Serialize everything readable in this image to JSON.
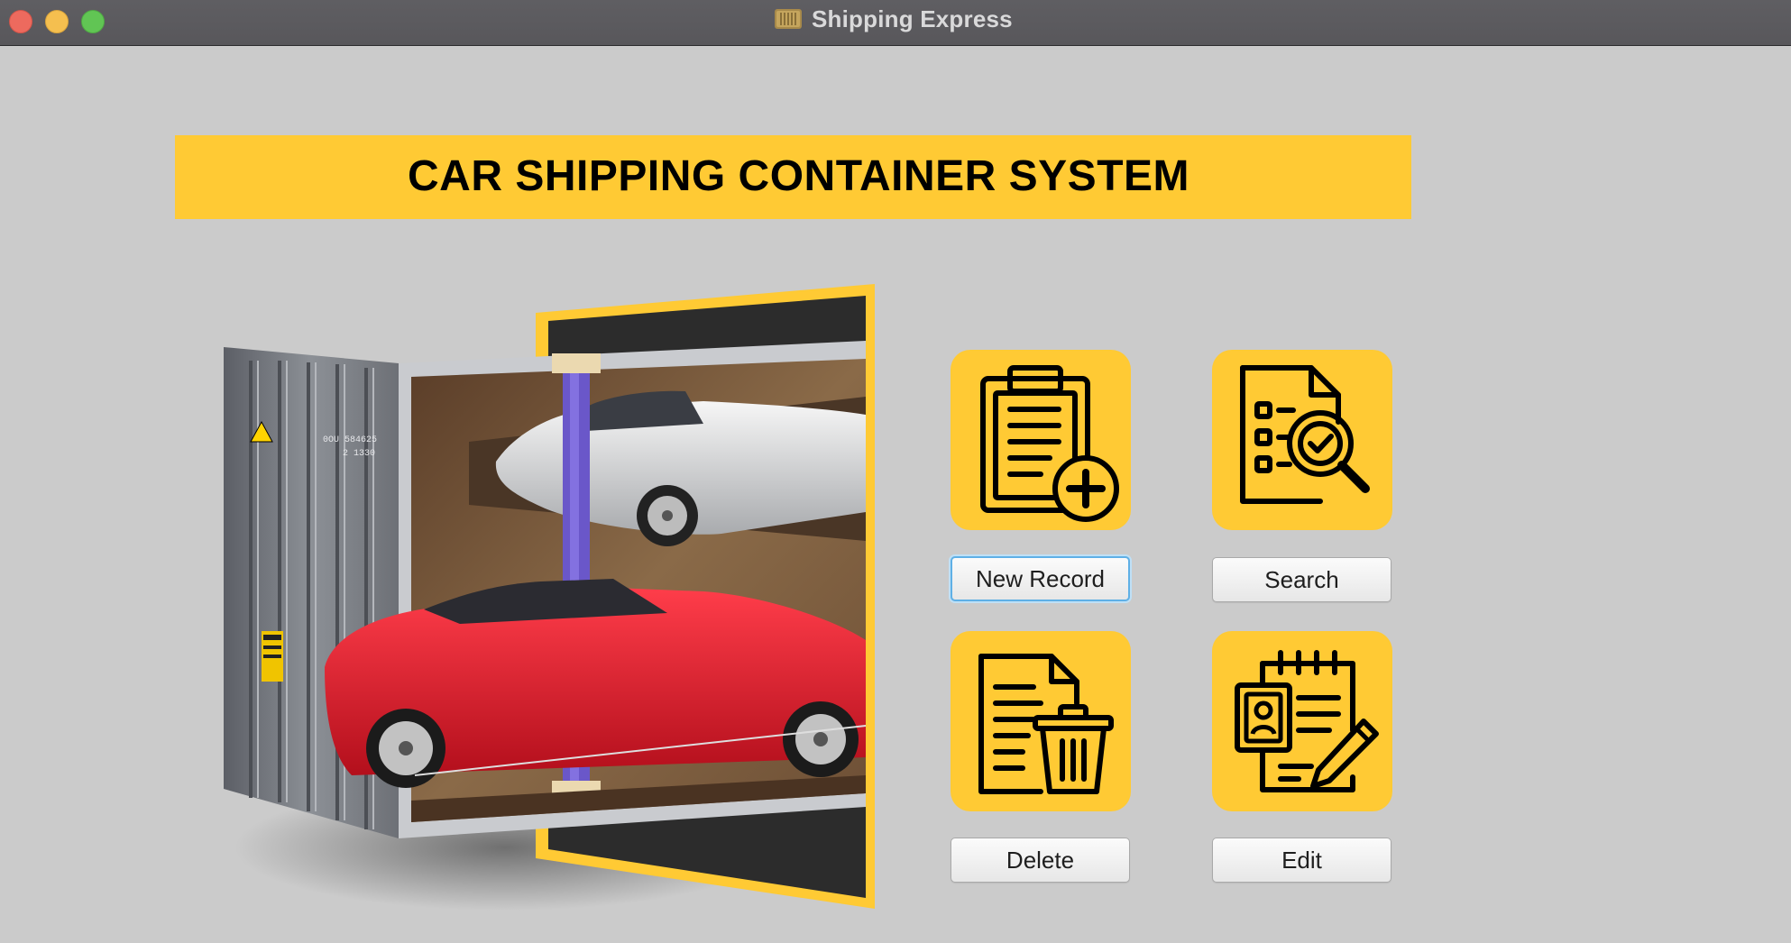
{
  "window": {
    "title": "Shipping Express",
    "icon": "shipping-container-icon"
  },
  "banner": {
    "title": "CAR SHIPPING CONTAINER SYSTEM"
  },
  "hero": {
    "image": "container-with-cars-illustration"
  },
  "actions": [
    {
      "label": "New Record",
      "icon": "clipboard-add-icon"
    },
    {
      "label": "Search",
      "icon": "document-search-icon"
    },
    {
      "label": "Delete",
      "icon": "document-delete-icon"
    },
    {
      "label": "Edit",
      "icon": "notebook-edit-icon"
    }
  ],
  "colors": {
    "accent": "#ffca34",
    "background": "#cbcbcb",
    "titlebar": "#5c5b5f",
    "focus": "#5fb0e6"
  }
}
